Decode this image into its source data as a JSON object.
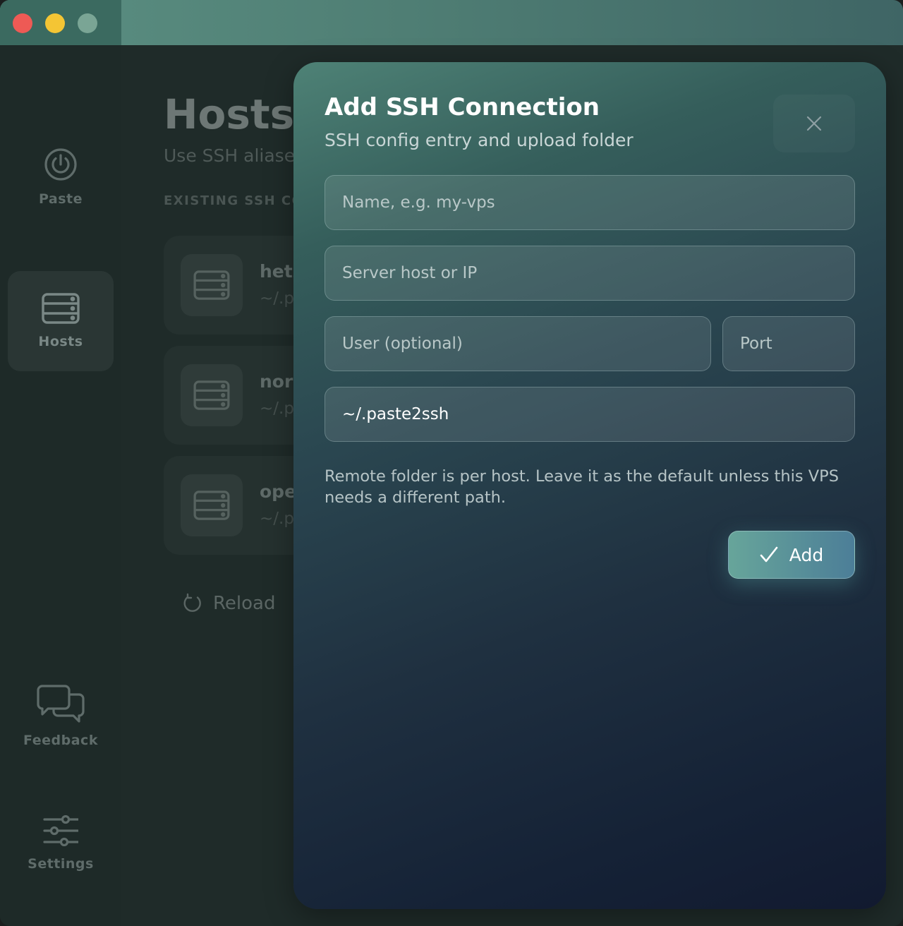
{
  "sidebar": {
    "items": [
      {
        "label": "Paste",
        "icon": "power-icon"
      },
      {
        "label": "Hosts",
        "icon": "server-icon",
        "active": true
      },
      {
        "label": "Feedback",
        "icon": "chat-bubbles-icon"
      },
      {
        "label": "Settings",
        "icon": "sliders-icon"
      }
    ]
  },
  "main": {
    "title": "Hosts",
    "subtitle": "Use SSH aliase",
    "section_header": "EXISTING SSH CO",
    "hosts": [
      {
        "name": "hetz",
        "path": "~/.pa"
      },
      {
        "name": "norl",
        "path": "~/.pa"
      },
      {
        "name": "ope",
        "path": "~/.pa"
      }
    ],
    "reload_label": "Reload"
  },
  "modal": {
    "title": "Add SSH Connection",
    "subtitle": "SSH config entry and upload folder",
    "fields": {
      "name_placeholder": "Name, e.g. my-vps",
      "host_placeholder": "Server host or IP",
      "user_placeholder": "User (optional)",
      "port_placeholder": "Port",
      "folder_value": "~/.paste2ssh"
    },
    "hint": "Remote folder is per host. Leave it as the default unless this VPS needs a different path.",
    "add_label": "Add"
  },
  "colors": {
    "accent_start": "#67a59a",
    "accent_end": "#4c7e98",
    "traffic_close": "#ee5a55",
    "traffic_min": "#f4c534",
    "traffic_max": "#7aa595"
  }
}
